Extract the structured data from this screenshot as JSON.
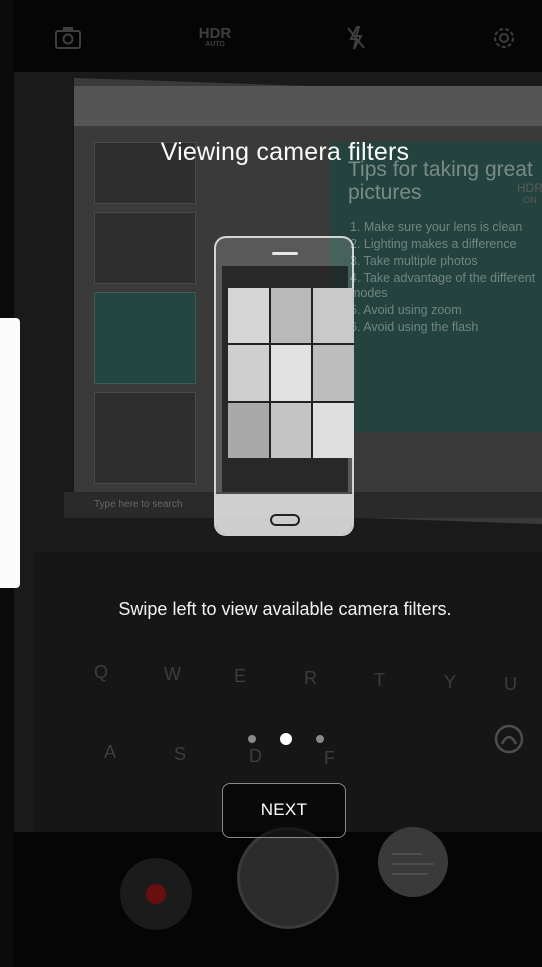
{
  "tutorial": {
    "title": "Viewing camera filters",
    "description": "Swipe left to view available camera filters.",
    "next_label": "NEXT",
    "pager": {
      "count": 3,
      "active_index": 1
    }
  },
  "topbar": {
    "hdr_label": "HDR",
    "hdr_mode": "AUTO",
    "icons": [
      "switch-camera-icon",
      "hdr-icon",
      "flash-off-icon",
      "settings-icon"
    ]
  },
  "background": {
    "hdr_overlay_top": "HDR",
    "hdr_overlay_bottom": "ON",
    "slide_title": "Tips for taking great pictures",
    "slide_items": [
      "1. Make sure your lens is clean",
      "2. Lighting makes a difference",
      "3. Take multiple photos",
      "4. Take advantage of the different modes",
      "5. Avoid using zoom",
      "6. Avoid using the flash"
    ],
    "taskbar_search": "Type here to search",
    "keys": [
      "Q",
      "W",
      "E",
      "R",
      "T",
      "Y",
      "U",
      "A",
      "S",
      "D",
      "F"
    ]
  },
  "filter_cells": [
    "#d6d6d6",
    "#b9b9b9",
    "#c9c9c9",
    "#cfcfcf",
    "#e2e2e2",
    "#bdbdbd",
    "#a9a9a9",
    "#c4c4c4",
    "#dedede"
  ],
  "colors": {
    "record_dot": "#6a0f0f",
    "edge_handle": "#fbfbfb"
  }
}
